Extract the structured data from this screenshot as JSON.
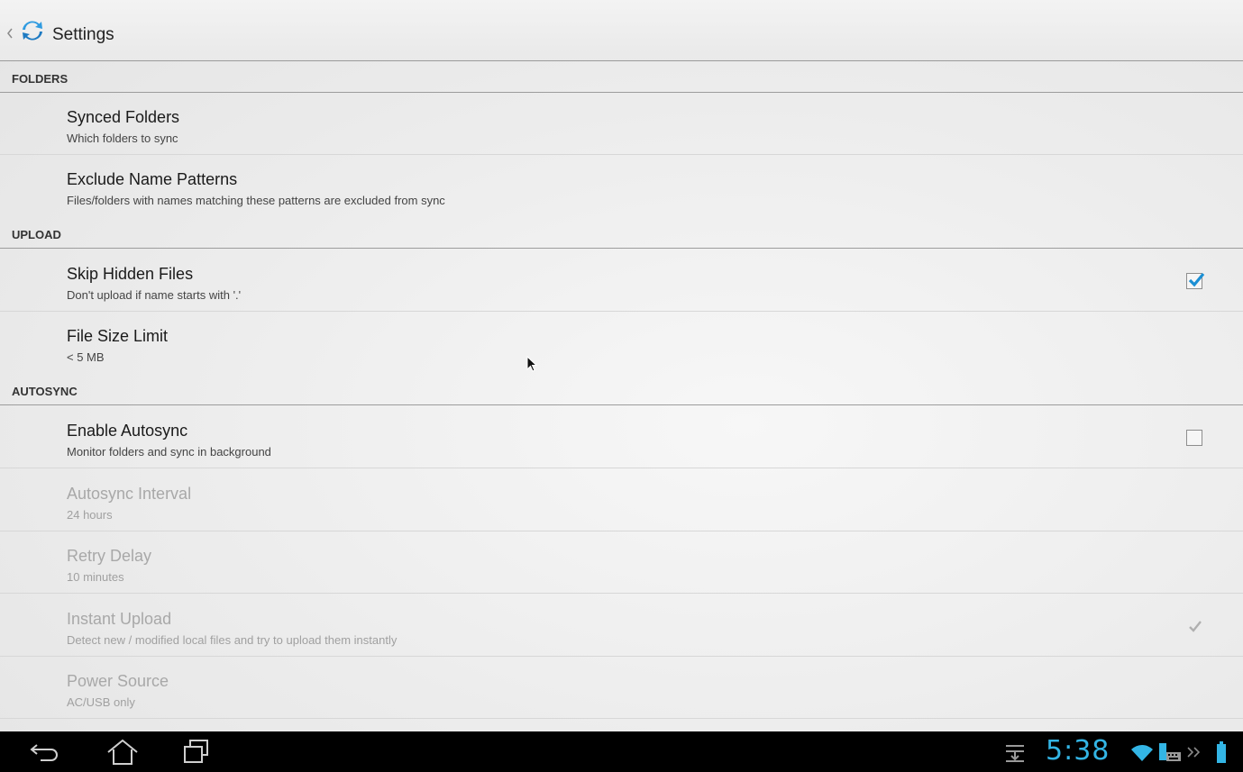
{
  "app": {
    "title": "Settings"
  },
  "sections": [
    {
      "header": "FOLDERS"
    },
    {
      "header": "UPLOAD"
    },
    {
      "header": "AUTOSYNC"
    }
  ],
  "items": {
    "synced_folders": {
      "title": "Synced Folders",
      "summary": "Which folders to sync"
    },
    "exclude_patterns": {
      "title": "Exclude Name Patterns",
      "summary": "Files/folders with names matching these patterns are excluded from sync"
    },
    "skip_hidden": {
      "title": "Skip Hidden Files",
      "summary": "Don't upload if name starts with '.'",
      "checked": true
    },
    "file_size_limit": {
      "title": "File Size Limit",
      "summary": "< 5 MB"
    },
    "enable_autosync": {
      "title": "Enable Autosync",
      "summary": "Monitor folders and sync in background",
      "checked": false
    },
    "autosync_interval": {
      "title": "Autosync Interval",
      "summary": "24 hours",
      "enabled": false
    },
    "retry_delay": {
      "title": "Retry Delay",
      "summary": "10 minutes",
      "enabled": false
    },
    "instant_upload": {
      "title": "Instant Upload",
      "summary": "Detect new / modified local files and try to upload them instantly",
      "checked": true,
      "enabled": false
    },
    "power_source": {
      "title": "Power Source",
      "summary": "AC/USB only",
      "enabled": false
    }
  },
  "statusbar": {
    "time": "5:38",
    "icons": [
      "download-icon",
      "wifi-icon",
      "keyboard-icon",
      "chevron-icon",
      "battery-icon"
    ]
  },
  "navbar": {
    "icons": [
      "back-icon",
      "home-icon",
      "recent-apps-icon"
    ]
  },
  "colors": {
    "accent": "#33b5e5",
    "checkbox_blue": "#1b8fd4"
  }
}
